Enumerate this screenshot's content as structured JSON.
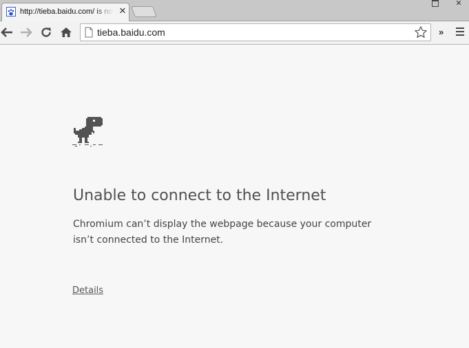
{
  "tab": {
    "title": "http://tieba.baidu.com/ is not available",
    "close_glyph": "✕",
    "favicon": "paw-icon"
  },
  "window_controls": {
    "restore_icon": "restore-icon",
    "close_glyph": "✕"
  },
  "toolbar": {
    "back_icon": "back-arrow-icon",
    "forward_icon": "forward-arrow-icon",
    "reload_icon": "reload-icon",
    "home_icon": "home-icon",
    "extensions_glyph": "»",
    "menu_icon": "hamburger-menu-icon"
  },
  "omnibox": {
    "url": "tieba.baidu.com",
    "page_icon": "page-icon",
    "bookmark_icon": "star-icon"
  },
  "error_page": {
    "icon": "offline-dinosaur-icon",
    "title": "Unable to connect to the Internet",
    "body": "Chromium can’t display the webpage because your computer isn’t connected to the Internet.",
    "details_link": "Details"
  },
  "colors": {
    "page_background": "#f7f7f7",
    "title_text": "#505050",
    "tabstrip": "#c8c8c8"
  }
}
